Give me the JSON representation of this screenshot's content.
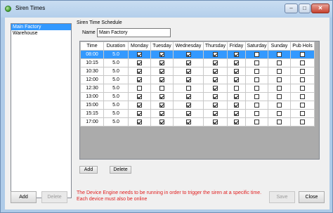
{
  "window": {
    "title": "Siren Times"
  },
  "sites": [
    {
      "label": "Main Factory",
      "selected": true
    },
    {
      "label": "Warehouse",
      "selected": false
    }
  ],
  "schedule": {
    "title": "Siren Time Schedule",
    "name_label": "Name",
    "name_value": "Main Factory",
    "columns": [
      "Time",
      "Duration",
      "Monday",
      "Tuesday",
      "Wednesday",
      "Thursday",
      "Friday",
      "Saturday",
      "Sunday",
      "Pub Hols"
    ],
    "rows": [
      {
        "time": "08:00",
        "duration": "5.0",
        "days": [
          true,
          true,
          true,
          true,
          true,
          false,
          false,
          false
        ],
        "selected": true
      },
      {
        "time": "10:15",
        "duration": "5.0",
        "days": [
          true,
          true,
          true,
          true,
          true,
          false,
          false,
          false
        ]
      },
      {
        "time": "10:30",
        "duration": "5.0",
        "days": [
          true,
          true,
          true,
          true,
          true,
          false,
          false,
          false
        ]
      },
      {
        "time": "12:00",
        "duration": "5.0",
        "days": [
          true,
          true,
          true,
          true,
          true,
          false,
          false,
          false
        ]
      },
      {
        "time": "12:30",
        "duration": "5.0",
        "days": [
          false,
          false,
          false,
          true,
          false,
          false,
          false,
          false
        ]
      },
      {
        "time": "13:00",
        "duration": "5.0",
        "days": [
          true,
          true,
          true,
          true,
          true,
          false,
          false,
          false
        ]
      },
      {
        "time": "15:00",
        "duration": "5.0",
        "days": [
          true,
          true,
          true,
          true,
          true,
          false,
          false,
          false
        ]
      },
      {
        "time": "15:15",
        "duration": "5.0",
        "days": [
          true,
          true,
          true,
          true,
          true,
          false,
          false,
          false
        ]
      },
      {
        "time": "17:00",
        "duration": "5.0",
        "days": [
          true,
          true,
          true,
          true,
          true,
          false,
          false,
          false
        ]
      }
    ],
    "add_label": "Add",
    "delete_label": "Delete"
  },
  "footer": {
    "add_label": "Add",
    "delete_label": "Delete",
    "warning_line1": "The Device Engine needs to be running in order to trigger the siren at a specific time.",
    "warning_line2": "Each device must also be online",
    "save_label": "Save",
    "close_label": "Close"
  },
  "colors": {
    "selection": "#3399ff",
    "warning": "#e02020"
  },
  "icons": {
    "app": "siren-app-icon",
    "minimize": "minimize-icon",
    "maximize": "maximize-icon",
    "close": "close-icon"
  }
}
